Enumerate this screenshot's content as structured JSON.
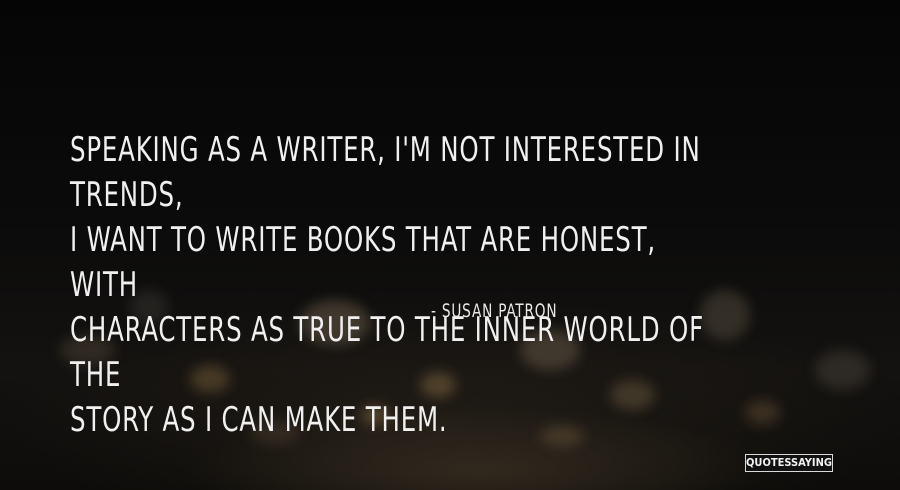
{
  "quote": {
    "text": "SPEAKING AS A WRITER, I'M NOT INTERESTED IN TRENDS,\nI WANT TO WRITE BOOKS THAT ARE HONEST, WITH\nCHARACTERS AS TRUE TO THE INNER WORLD OF THE\nSTORY AS I CAN MAKE THEM.",
    "author": "- SUSAN PATRON"
  },
  "watermark": {
    "text": "QUOTESSAYINGS.NET"
  },
  "colors": {
    "text": "#f0f0f0",
    "background": "#070707",
    "bokeh_warm": "#b58a55",
    "bokeh_cool": "#8d8a80"
  }
}
